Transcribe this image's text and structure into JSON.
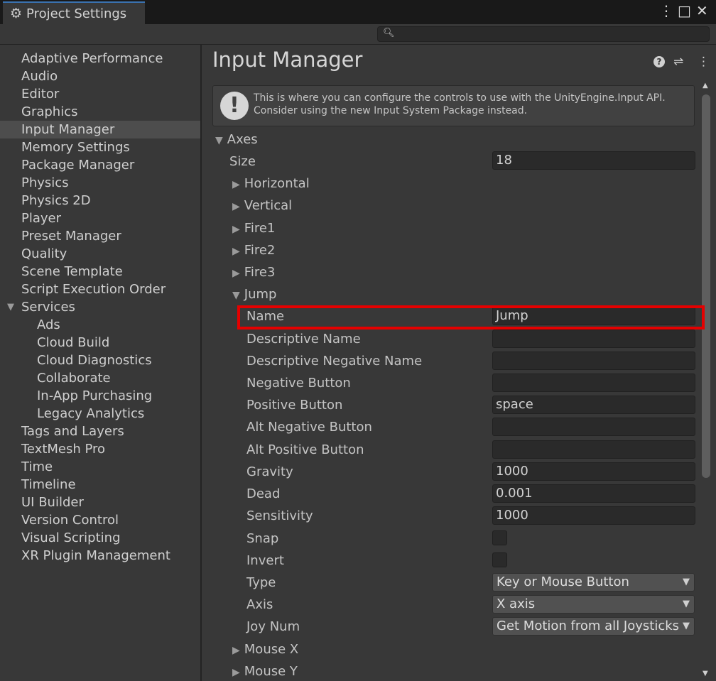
{
  "window": {
    "tab_title": "Project Settings",
    "tab_icon": "gear-icon",
    "controls": {
      "menu": "⋮",
      "maximize": "□",
      "close": "✕"
    }
  },
  "search": {
    "placeholder": "",
    "value": ""
  },
  "sidebar": {
    "items": [
      {
        "label": "Adaptive Performance"
      },
      {
        "label": "Audio"
      },
      {
        "label": "Editor"
      },
      {
        "label": "Graphics"
      },
      {
        "label": "Input Manager",
        "selected": true
      },
      {
        "label": "Memory Settings"
      },
      {
        "label": "Package Manager"
      },
      {
        "label": "Physics"
      },
      {
        "label": "Physics 2D"
      },
      {
        "label": "Player"
      },
      {
        "label": "Preset Manager"
      },
      {
        "label": "Quality"
      },
      {
        "label": "Scene Template"
      },
      {
        "label": "Script Execution Order"
      },
      {
        "label": "Services",
        "expanded": true
      },
      {
        "label": "Ads",
        "child": true
      },
      {
        "label": "Cloud Build",
        "child": true
      },
      {
        "label": "Cloud Diagnostics",
        "child": true
      },
      {
        "label": "Collaborate",
        "child": true
      },
      {
        "label": "In-App Purchasing",
        "child": true
      },
      {
        "label": "Legacy Analytics",
        "child": true
      },
      {
        "label": "Tags and Layers"
      },
      {
        "label": "TextMesh Pro"
      },
      {
        "label": "Time"
      },
      {
        "label": "Timeline"
      },
      {
        "label": "UI Builder"
      },
      {
        "label": "Version Control"
      },
      {
        "label": "Visual Scripting"
      },
      {
        "label": "XR Plugin Management"
      }
    ]
  },
  "main": {
    "title": "Input Manager",
    "header_icons": [
      "help-icon",
      "preset-icon",
      "menu-icon"
    ],
    "info": "This is where you can configure the controls to use with the UnityEngine.Input API. Consider using the new Input System Package instead.",
    "axes_label": "Axes",
    "size_label": "Size",
    "size_value": "18",
    "collapsed_axes": [
      "Horizontal",
      "Vertical",
      "Fire1",
      "Fire2",
      "Fire3"
    ],
    "expanded_axis": "Jump",
    "jump_fields": {
      "name_label": "Name",
      "name_value": "Jump",
      "descriptive_name_label": "Descriptive Name",
      "descriptive_name_value": "",
      "descriptive_negative_name_label": "Descriptive Negative Name",
      "descriptive_negative_name_value": "",
      "negative_button_label": "Negative Button",
      "negative_button_value": "",
      "positive_button_label": "Positive Button",
      "positive_button_value": "space",
      "alt_negative_button_label": "Alt Negative Button",
      "alt_negative_button_value": "",
      "alt_positive_button_label": "Alt Positive Button",
      "alt_positive_button_value": "",
      "gravity_label": "Gravity",
      "gravity_value": "1000",
      "dead_label": "Dead",
      "dead_value": "0.001",
      "sensitivity_label": "Sensitivity",
      "sensitivity_value": "1000",
      "snap_label": "Snap",
      "snap_checked": false,
      "invert_label": "Invert",
      "invert_checked": false,
      "type_label": "Type",
      "type_value": "Key or Mouse Button",
      "axis_label": "Axis",
      "axis_value": "X axis",
      "joy_num_label": "Joy Num",
      "joy_num_value": "Get Motion from all Joysticks"
    },
    "trailing_axes": [
      "Mouse X",
      "Mouse Y"
    ]
  },
  "highlight_color": "#e50000"
}
